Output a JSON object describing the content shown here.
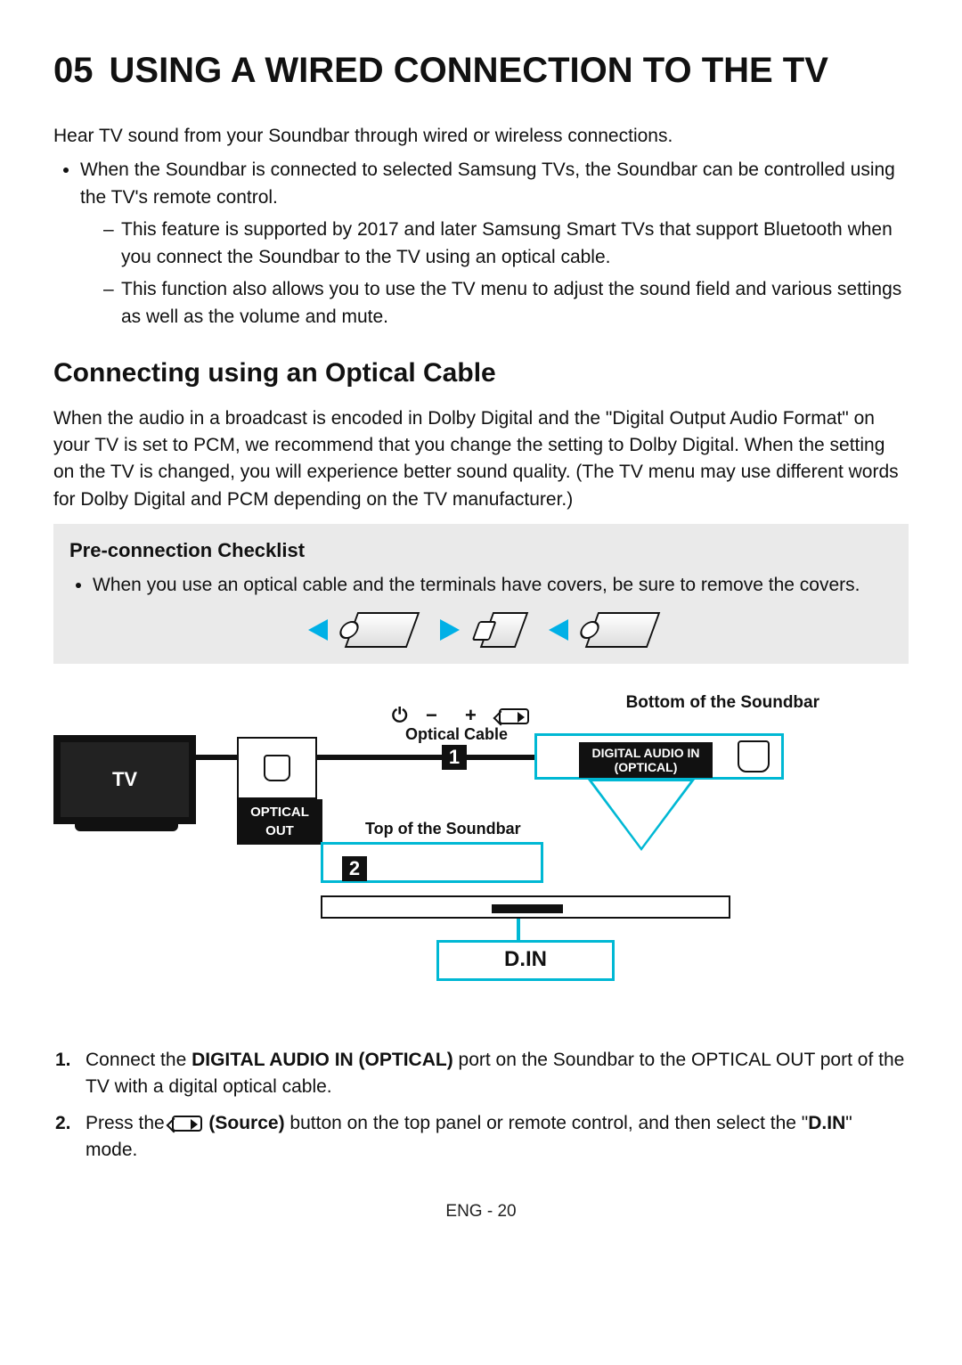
{
  "section": {
    "number": "05",
    "title": "USING A WIRED CONNECTION TO THE TV"
  },
  "intro": "Hear TV sound from your Soundbar through wired or wireless connections.",
  "top_bullet": "When the Soundbar is connected to selected Samsung TVs, the Soundbar can be controlled using the TV's remote control.",
  "dashes": [
    "This feature is supported by 2017 and later Samsung Smart TVs that support Bluetooth when you connect the Soundbar to the TV using an optical cable.",
    "This function also allows you to use the TV menu to adjust the sound field and various settings as well as the volume and mute."
  ],
  "subheading": "Connecting using an Optical Cable",
  "optical_intro": "When the audio in a broadcast is encoded in Dolby Digital and the \"Digital Output Audio Format\" on your TV is set to PCM, we recommend that you change the setting to Dolby Digital. When the setting on the TV is changed, you will experience better sound quality. (The TV menu may use different words for Dolby Digital and PCM depending on the TV manufacturer.)",
  "checklist": {
    "title": "Pre-connection Checklist",
    "item": "When you use an optical cable and the terminals have covers, be sure to remove the covers."
  },
  "diagram": {
    "bottom_label": "Bottom of the Soundbar",
    "optical_cable_label": "Optical Cable",
    "top_label": "Top of the Soundbar",
    "tv_label": "TV",
    "optical_out": "OPTICAL OUT",
    "din_port_line1": "DIGITAL AUDIO IN",
    "din_port_line2": "(OPTICAL)",
    "din_mode": "D.IN",
    "step1_badge": "1",
    "step2_badge": "2"
  },
  "steps": {
    "s1_num": "1.",
    "s1_a": "Connect the ",
    "s1_bold": "DIGITAL AUDIO IN (OPTICAL)",
    "s1_b": " port on the Soundbar to the OPTICAL OUT port of the TV with a digital optical cable.",
    "s2_num": "2.",
    "s2_a": "Press the ",
    "s2_bold": "(Source)",
    "s2_b": " button on the top panel or remote control, and then select the \"",
    "s2_din": "D.IN",
    "s2_c": "\" mode."
  },
  "footer": "ENG - 20"
}
